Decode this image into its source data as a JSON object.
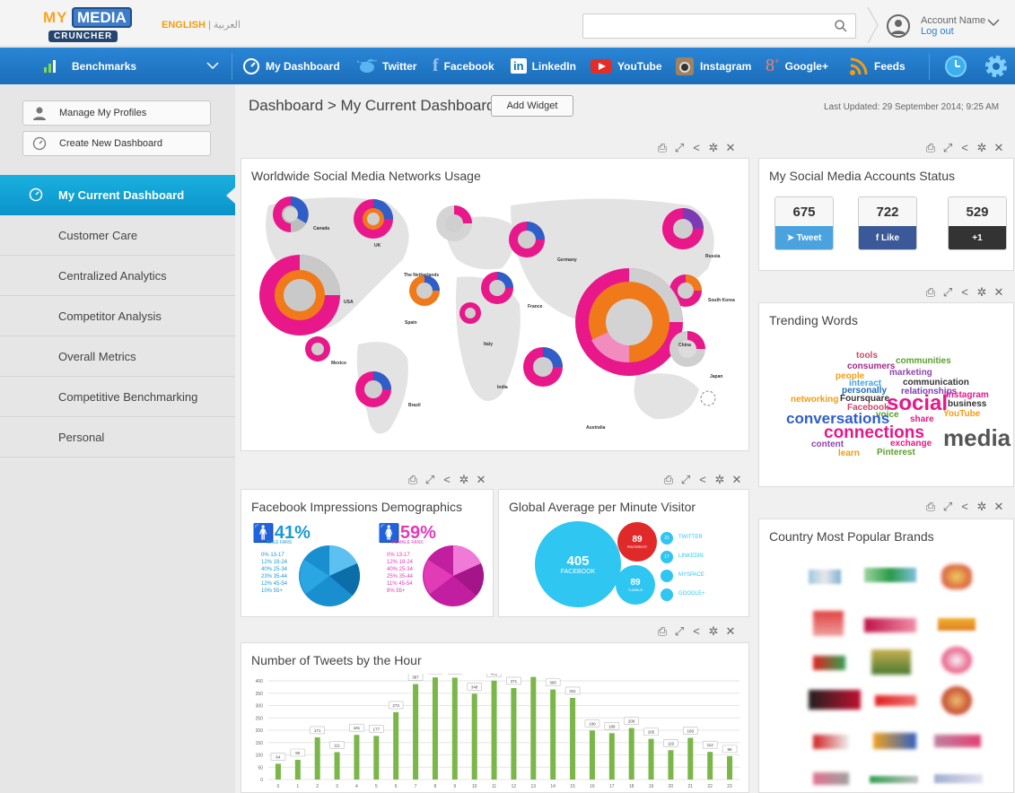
{
  "brand": {
    "logo_my": "MY",
    "logo_media": "MEDIA",
    "logo_cruncher": "CRUNCHER"
  },
  "header": {
    "lang_en": "ENGLISH",
    "lang_ar": "العربية",
    "account_name": "Account Name",
    "logout": "Log out",
    "search_placeholder": ""
  },
  "nav": {
    "benchmarks": "Benchmarks",
    "items": [
      {
        "label": "My Dashboard",
        "icon": "dashboard-gauge-icon"
      },
      {
        "label": "Twitter",
        "icon": "twitter-bird-icon",
        "color": "#3aa6e8"
      },
      {
        "label": "Facebook",
        "icon": "facebook-f-icon",
        "color": "#3b5998"
      },
      {
        "label": "LinkedIn",
        "icon": "linkedin-icon",
        "color": "#0e76a8"
      },
      {
        "label": "YouTube",
        "icon": "youtube-play-icon",
        "color": "#e52d27"
      },
      {
        "label": "Instagram",
        "icon": "instagram-camera-icon",
        "color": "#8a6a4e"
      },
      {
        "label": "Google+",
        "icon": "google-plus-icon",
        "color": "#dd4b39"
      },
      {
        "label": "Feeds",
        "icon": "rss-feed-icon",
        "color": "#f39c12"
      }
    ]
  },
  "sidebar": {
    "manage_profiles": "Manage My Profiles",
    "create_dashboard": "Create New Dashboard",
    "items": [
      "My Current Dashboard",
      "Customer Care",
      "Centralized Analytics",
      "Competitor Analysis",
      "Overall Metrics",
      "Competitive Benchmarking",
      "Personal"
    ],
    "active_index": 0
  },
  "main": {
    "breadcrumb": "Dashboard > My Current Dashboard",
    "add_widget": "Add Widget",
    "last_updated": "Last Updated: 29 September 2014; 9:25 AM"
  },
  "widgets": {
    "map": {
      "title": "Worldwide Social Media Networks Usage",
      "countries": [
        "Canada",
        "UK",
        "Russia",
        "The Netherlands",
        "Germany",
        "USA",
        "South Korea",
        "France",
        "Spain",
        "Italy",
        "China",
        "Mexico",
        "India",
        "Japan",
        "Brazil",
        "Australia"
      ]
    },
    "status": {
      "title": "My Social Media Accounts Status",
      "items": [
        {
          "count": "675",
          "label": "Tweet",
          "color": "#4aa3df"
        },
        {
          "count": "722",
          "label": "Like",
          "color": "#3b5998"
        },
        {
          "count": "529",
          "label": "+1",
          "color": "#333333"
        }
      ]
    },
    "trending": {
      "title": "Trending Words"
    },
    "fb": {
      "title": "Facebook Impressions Demographics",
      "male": {
        "pct": "41%",
        "label": "MALE FANS",
        "color": "#1a9ad6",
        "rows": [
          "0% 13-17",
          "12% 18-24",
          "40% 25-34",
          "23% 35-44",
          "12% 45-54",
          "10% 55+"
        ]
      },
      "female": {
        "pct": "59%",
        "label": "FEMALE FANS",
        "color": "#e23bb7",
        "rows": [
          "0% 13-17",
          "12% 18-24",
          "40% 25-34",
          "25% 35-44",
          "11% 45-54",
          "8% 55+"
        ]
      }
    },
    "visitor": {
      "title": "Global Average per Minute Visitor",
      "facebook": {
        "value": "405",
        "label": "FACEBOOK",
        "color": "#2fc6f1"
      },
      "pinterest": {
        "value": "89",
        "label": "PINTEREST",
        "color": "#e02a2a"
      },
      "tumblr": {
        "value": "89",
        "label": "TUMBLR",
        "color": "#2fc6f1"
      },
      "legend": [
        {
          "v": "21",
          "label": "TWITTER"
        },
        {
          "v": "17",
          "label": "LINKEDIN"
        },
        {
          "v": "",
          "label": "MYSPACE"
        },
        {
          "v": "",
          "label": "GOOGLE+"
        }
      ]
    },
    "brands": {
      "title": "Country Most Popular Brands"
    },
    "tweets": {
      "title": "Number of Tweets by the Hour"
    }
  },
  "chart_data": {
    "type": "bar",
    "title": "Number of Tweets by the Hour",
    "categories": [
      "0",
      "1",
      "2",
      "3",
      "4",
      "5",
      "6",
      "7",
      "8",
      "9",
      "10",
      "11",
      "12",
      "13",
      "14",
      "15",
      "16",
      "17",
      "18",
      "19",
      "20",
      "21",
      "22",
      "23"
    ],
    "values": [
      64,
      80,
      171,
      111,
      181,
      177,
      273,
      387,
      414,
      413,
      348,
      401,
      371,
      416,
      365,
      331,
      199,
      188,
      209,
      165,
      119,
      169,
      112,
      95
    ],
    "ylim": [
      0,
      400
    ],
    "yticks": [
      0,
      50,
      100,
      150,
      200,
      250,
      300,
      350,
      400
    ],
    "bar_color": "#7ab648",
    "grid": true
  }
}
